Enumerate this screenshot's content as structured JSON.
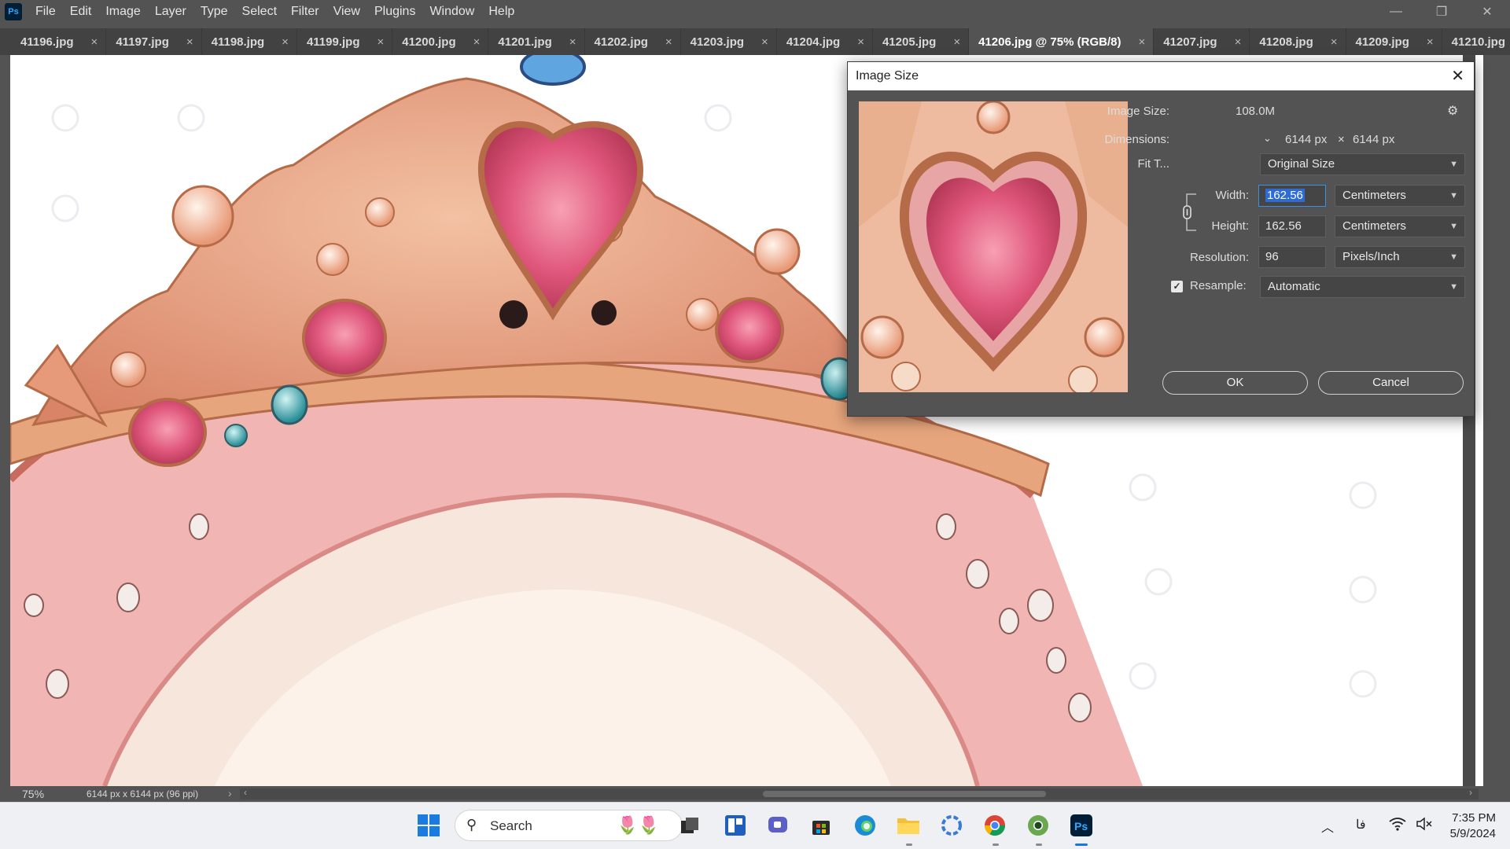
{
  "app": {
    "logo": "Ps"
  },
  "menu": [
    "File",
    "Edit",
    "Image",
    "Layer",
    "Type",
    "Select",
    "Filter",
    "View",
    "Plugins",
    "Window",
    "Help"
  ],
  "window_controls": {
    "minimize": "—",
    "restore": "❐",
    "close": "✕"
  },
  "tabs": [
    {
      "label": "41196.jpg"
    },
    {
      "label": "41197.jpg"
    },
    {
      "label": "41198.jpg"
    },
    {
      "label": "41199.jpg"
    },
    {
      "label": "41200.jpg"
    },
    {
      "label": "41201.jpg"
    },
    {
      "label": "41202.jpg"
    },
    {
      "label": "41203.jpg"
    },
    {
      "label": "41204.jpg"
    },
    {
      "label": "41205.jpg"
    },
    {
      "label": "41206.jpg @ 75% (RGB/8)"
    },
    {
      "label": "41207.jpg"
    },
    {
      "label": "41208.jpg"
    },
    {
      "label": "41209.jpg"
    },
    {
      "label": "41210.jpg"
    }
  ],
  "active_tab": "41206.jpg @ 75% (RGB/8)",
  "tab_close": "×",
  "status": {
    "zoom": "75%",
    "doc_info": "6144 px x 6144 px (96 ppi)",
    "chevron": "›",
    "scroll_left": "‹",
    "scroll_right": "›"
  },
  "dialog": {
    "title": "Image Size",
    "close": "✕",
    "image_size_label": "Image Size:",
    "image_size_value": "108.0M",
    "dimensions_label": "Dimensions:",
    "dimensions_w": "6144 px",
    "dimensions_x": "×",
    "dimensions_h": "6144 px",
    "fit_to_label": "Fit T...",
    "fit_to_value": "Original Size",
    "width_label": "Width:",
    "width_value": "162.56",
    "width_unit": "Centimeters",
    "height_label": "Height:",
    "height_value": "162.56",
    "height_unit": "Centimeters",
    "resolution_label": "Resolution:",
    "resolution_value": "96",
    "resolution_unit": "Pixels/Inch",
    "resample_label": "Resample:",
    "resample_value": "Automatic",
    "resample_checked": true,
    "ok_label": "OK",
    "cancel_label": "Cancel",
    "chain_linked": true
  },
  "taskbar": {
    "search_label": "Search",
    "tray_lang": "فا",
    "time": "7:35 PM",
    "date": "5/9/2024",
    "apps": [
      "start-icon",
      "search-icon",
      "widgets-icon",
      "task-view-icon",
      "file-explorer-icon",
      "teams-icon",
      "store-icon",
      "edge-icon",
      "folder-icon",
      "snipping-tool-icon",
      "chrome-icon",
      "chrome-alt-icon",
      "photoshop-icon"
    ]
  },
  "colors": {
    "accent": "#31a8ff",
    "selection": "#2d6bd6",
    "taskbar_active": "#1a73e8"
  }
}
